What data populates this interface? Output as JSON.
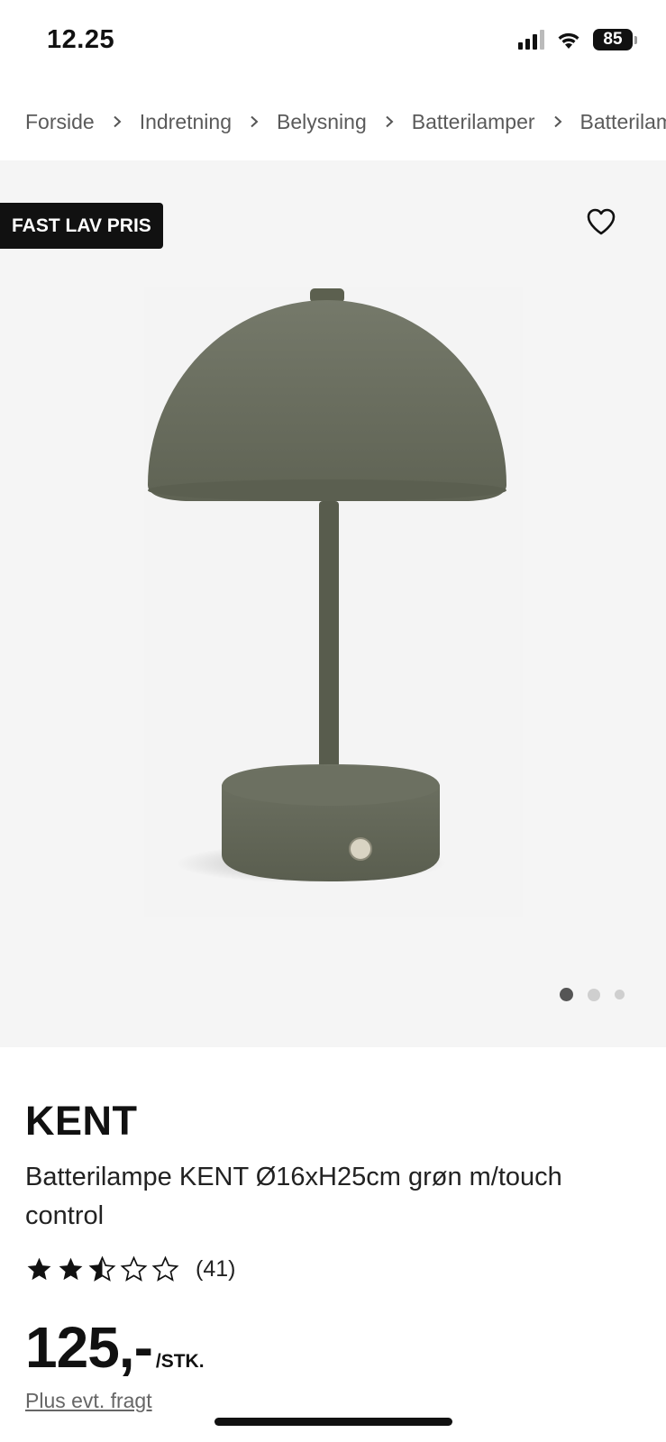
{
  "status_bar": {
    "time": "12.25",
    "battery": "85"
  },
  "breadcrumb": {
    "items": [
      "Forside",
      "Indretning",
      "Belysning",
      "Batterilamper",
      "Batterilamper"
    ]
  },
  "gallery": {
    "badge": "FAST LAV PRIS",
    "favorite_icon": "heart-icon",
    "dots_total": 3,
    "active_dot": 1
  },
  "product": {
    "brand": "KENT",
    "name": "Batterilampe KENT Ø16xH25cm grøn m/touch control",
    "rating": 2.5,
    "rating_max": 5,
    "review_count": "(41)",
    "price": "125,-",
    "price_unit": "/STK.",
    "shipping_note": "Plus evt. fragt"
  },
  "colors": {
    "badge_bg": "#111111",
    "gallery_bg": "#f5f5f5",
    "lamp_green": "#6b6f5e"
  }
}
